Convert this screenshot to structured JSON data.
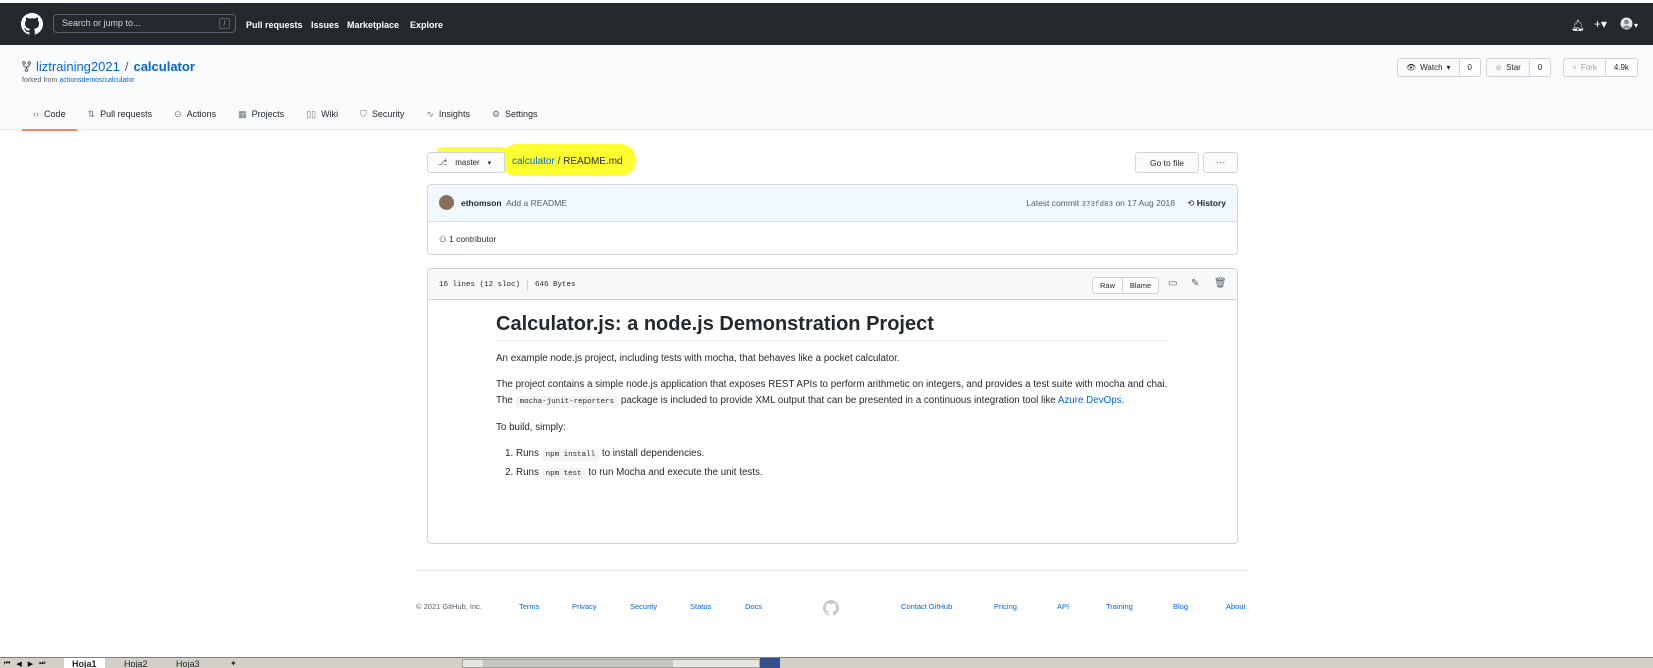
{
  "header": {
    "search_placeholder": "Search or jump to...",
    "search_shortcut": "/",
    "nav": [
      "Pull requests",
      "Issues",
      "Marketplace",
      "Explore"
    ]
  },
  "repo": {
    "owner": "liztraining2021",
    "separator": "/",
    "name": "calculator",
    "forked_prefix": "forked from",
    "forked_source": "actionsdemos/calculator",
    "watch_label": "Watch",
    "watch_count": "0",
    "star_label": "Star",
    "star_count": "0",
    "fork_label": "Fork",
    "fork_count": "4.9k"
  },
  "tabs": [
    {
      "label": "Code",
      "icon": "code-icon"
    },
    {
      "label": "Pull requests",
      "icon": "pull-request-icon"
    },
    {
      "label": "Actions",
      "icon": "play-icon"
    },
    {
      "label": "Projects",
      "icon": "project-icon"
    },
    {
      "label": "Wiki",
      "icon": "book-icon"
    },
    {
      "label": "Security",
      "icon": "shield-icon"
    },
    {
      "label": "Insights",
      "icon": "graph-icon"
    },
    {
      "label": "Settings",
      "icon": "gear-icon"
    }
  ],
  "file_nav": {
    "branch": "master",
    "path_repo": "calculator",
    "path_sep": "/",
    "path_file": "README.md",
    "goto_file": "Go to file",
    "more": "···"
  },
  "commit": {
    "author": "ethomson",
    "message": "Add a README",
    "latest_prefix": "Latest commit",
    "sha": "373fd83",
    "date": "on 17 Aug 2018",
    "history": "History",
    "contributors": "1 contributor"
  },
  "file": {
    "lines": "16 lines (12 sloc)",
    "size": "646 Bytes",
    "raw": "Raw",
    "blame": "Blame"
  },
  "readme": {
    "title": "Calculator.js: a node.js Demonstration Project",
    "p1": "An example node.js project, including tests with mocha, that behaves like a pocket calculator.",
    "p2_a": "The project contains a simple node.js application that exposes REST APIs to perform arithmetic on integers, and provides a test suite with mocha and chai. The",
    "p2_code": "mocha-junit-reporters",
    "p2_b": "package is included to provide XML output that can be presented in a continuous integration tool like",
    "p2_link": "Azure DevOps",
    "p2_end": ".",
    "p3": "To build, simply:",
    "steps": [
      {
        "pre": "Runs",
        "code": "npm install",
        "post": "to install dependencies."
      },
      {
        "pre": "Runs",
        "code": "npm test",
        "post": "to run Mocha and execute the unit tests."
      }
    ]
  },
  "footer": {
    "copyright": "© 2021 GitHub, Inc.",
    "left_links": [
      "Terms",
      "Privacy",
      "Security",
      "Status",
      "Docs"
    ],
    "right_links": [
      "Contact GitHub",
      "Pricing",
      "API",
      "Training",
      "Blog",
      "About"
    ]
  },
  "excel": {
    "sheets": [
      "Hoja1",
      "Hoja2",
      "Hoja3"
    ]
  },
  "colors": {
    "header_bg": "#24292e",
    "link": "#0366d6",
    "highlight": "#ffff00",
    "active_tab_underline": "#f9826c"
  }
}
